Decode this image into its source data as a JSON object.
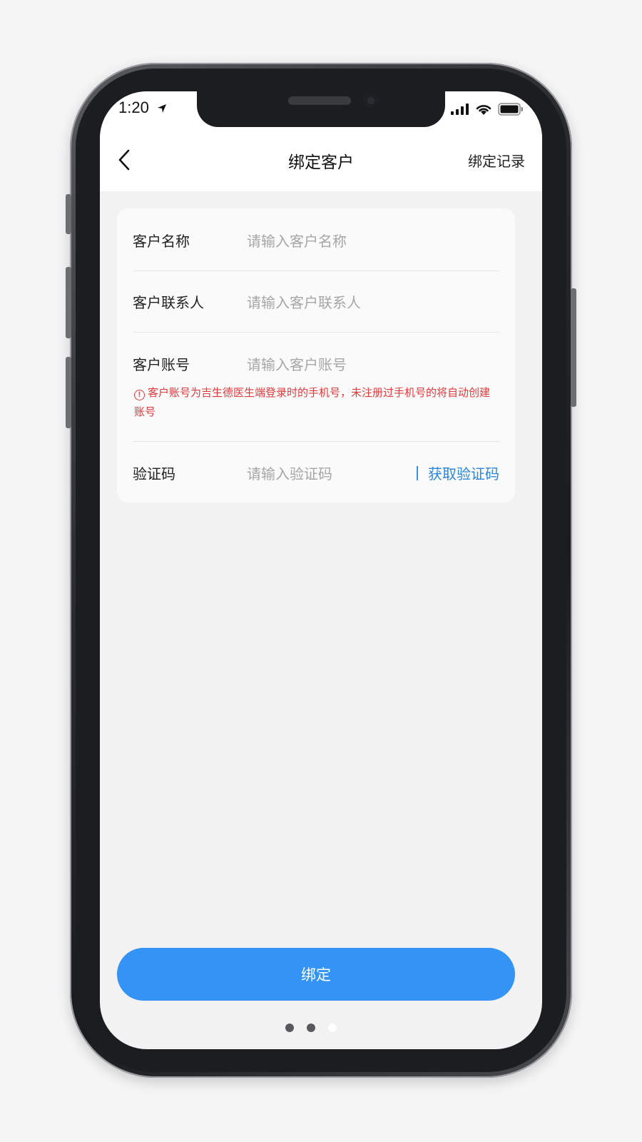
{
  "status_bar": {
    "time": "1:20",
    "icons": [
      "location-arrow-icon",
      "signal-icon",
      "wifi-icon",
      "battery-icon"
    ]
  },
  "nav": {
    "back_icon": "chevron-left-icon",
    "title": "绑定客户",
    "right_link": "绑定记录"
  },
  "form": {
    "customer_name": {
      "label": "客户名称",
      "placeholder": "请输入客户名称"
    },
    "customer_contact": {
      "label": "客户联系人",
      "placeholder": "请输入客户联系人"
    },
    "customer_account": {
      "label": "客户账号",
      "placeholder": "请输入客户账号",
      "warning_icon": "alert-circle-icon",
      "warning": "客户账号为吉生德医生端登录时的手机号，未注册过手机号的将自动创建账号"
    },
    "verification_code": {
      "label": "验证码",
      "placeholder": "请输入验证码",
      "get_code_label": "获取验证码"
    }
  },
  "submit": {
    "label": "绑定"
  },
  "colors": {
    "accent": "#3494f5",
    "link": "#2a86dc",
    "warning": "#e3393c",
    "background": "#f2f2f2"
  },
  "page_indicator": {
    "count": 3,
    "active_index": 2
  }
}
